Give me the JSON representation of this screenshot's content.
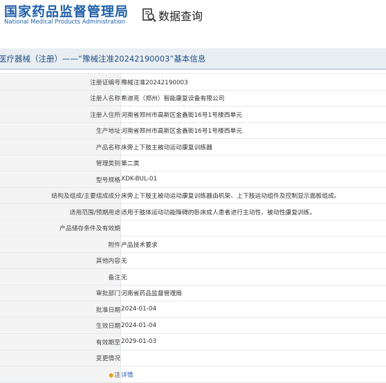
{
  "header": {
    "logo_cn": "国家药品监督管理局",
    "logo_en": "National Medical Products Administration",
    "query_title": "数据查询",
    "query_icon": "document-search-icon"
  },
  "bar_title": "医疗器械（注册）——“豫械注准20242190003”基本信息",
  "rows": [
    {
      "name": "registration-no",
      "label": "注册证编号",
      "value": "豫械注准20242190003"
    },
    {
      "name": "registrant-name",
      "label": "注册人名称",
      "value": "希迪克（郑州）智能康复设备有限公司"
    },
    {
      "name": "registrant-address",
      "label": "注册人住所",
      "value": "河南省郑州市高新区金鑫街16号1号楼西单元"
    },
    {
      "name": "production-address",
      "label": "生产地址",
      "value": "河南省郑州市高新区金鑫街16号1号楼西单元"
    },
    {
      "name": "product-name",
      "label": "产品名称",
      "value": "床旁上下肢主被动运动康复训练器"
    },
    {
      "name": "management-class",
      "label": "管理类别",
      "value": "第二类"
    },
    {
      "name": "model-spec",
      "label": "型号规格",
      "value": "XDK-BUL-01"
    },
    {
      "name": "structure",
      "label": "结构及组成/主要组成成分",
      "value": "床旁上下肢主被动运动康复训练器由机架、上下肢运动组件及控制显示面板组成。"
    },
    {
      "name": "intended-use",
      "label": "适用范围/预期用途",
      "value": "适用于肢体运动功能障碍的卧床成人患者进行主动性、被动性康复训练。"
    },
    {
      "name": "storage",
      "label": "产品储存条件及有效期",
      "value": ""
    },
    {
      "name": "attachment",
      "label": "附件",
      "value": "产品技术要求"
    },
    {
      "name": "other-content",
      "label": "其他内容",
      "value": "无"
    },
    {
      "name": "remarks",
      "label": "备注",
      "value": "无"
    },
    {
      "name": "approval-dept",
      "label": "审批部门",
      "value": "河南省药品监督管理局"
    },
    {
      "name": "approval-date",
      "label": "批准日期",
      "value": "2024-01-04"
    },
    {
      "name": "effective-date",
      "label": "生效日期",
      "value": "2024-01-04"
    },
    {
      "name": "expiry-date",
      "label": "有效期至",
      "value": "2029-01-03"
    },
    {
      "name": "change-info",
      "label": "变更情况",
      "value": ""
    }
  ],
  "note_row": {
    "label": "注",
    "value": "详情",
    "icon": "lightbulb-icon"
  }
}
